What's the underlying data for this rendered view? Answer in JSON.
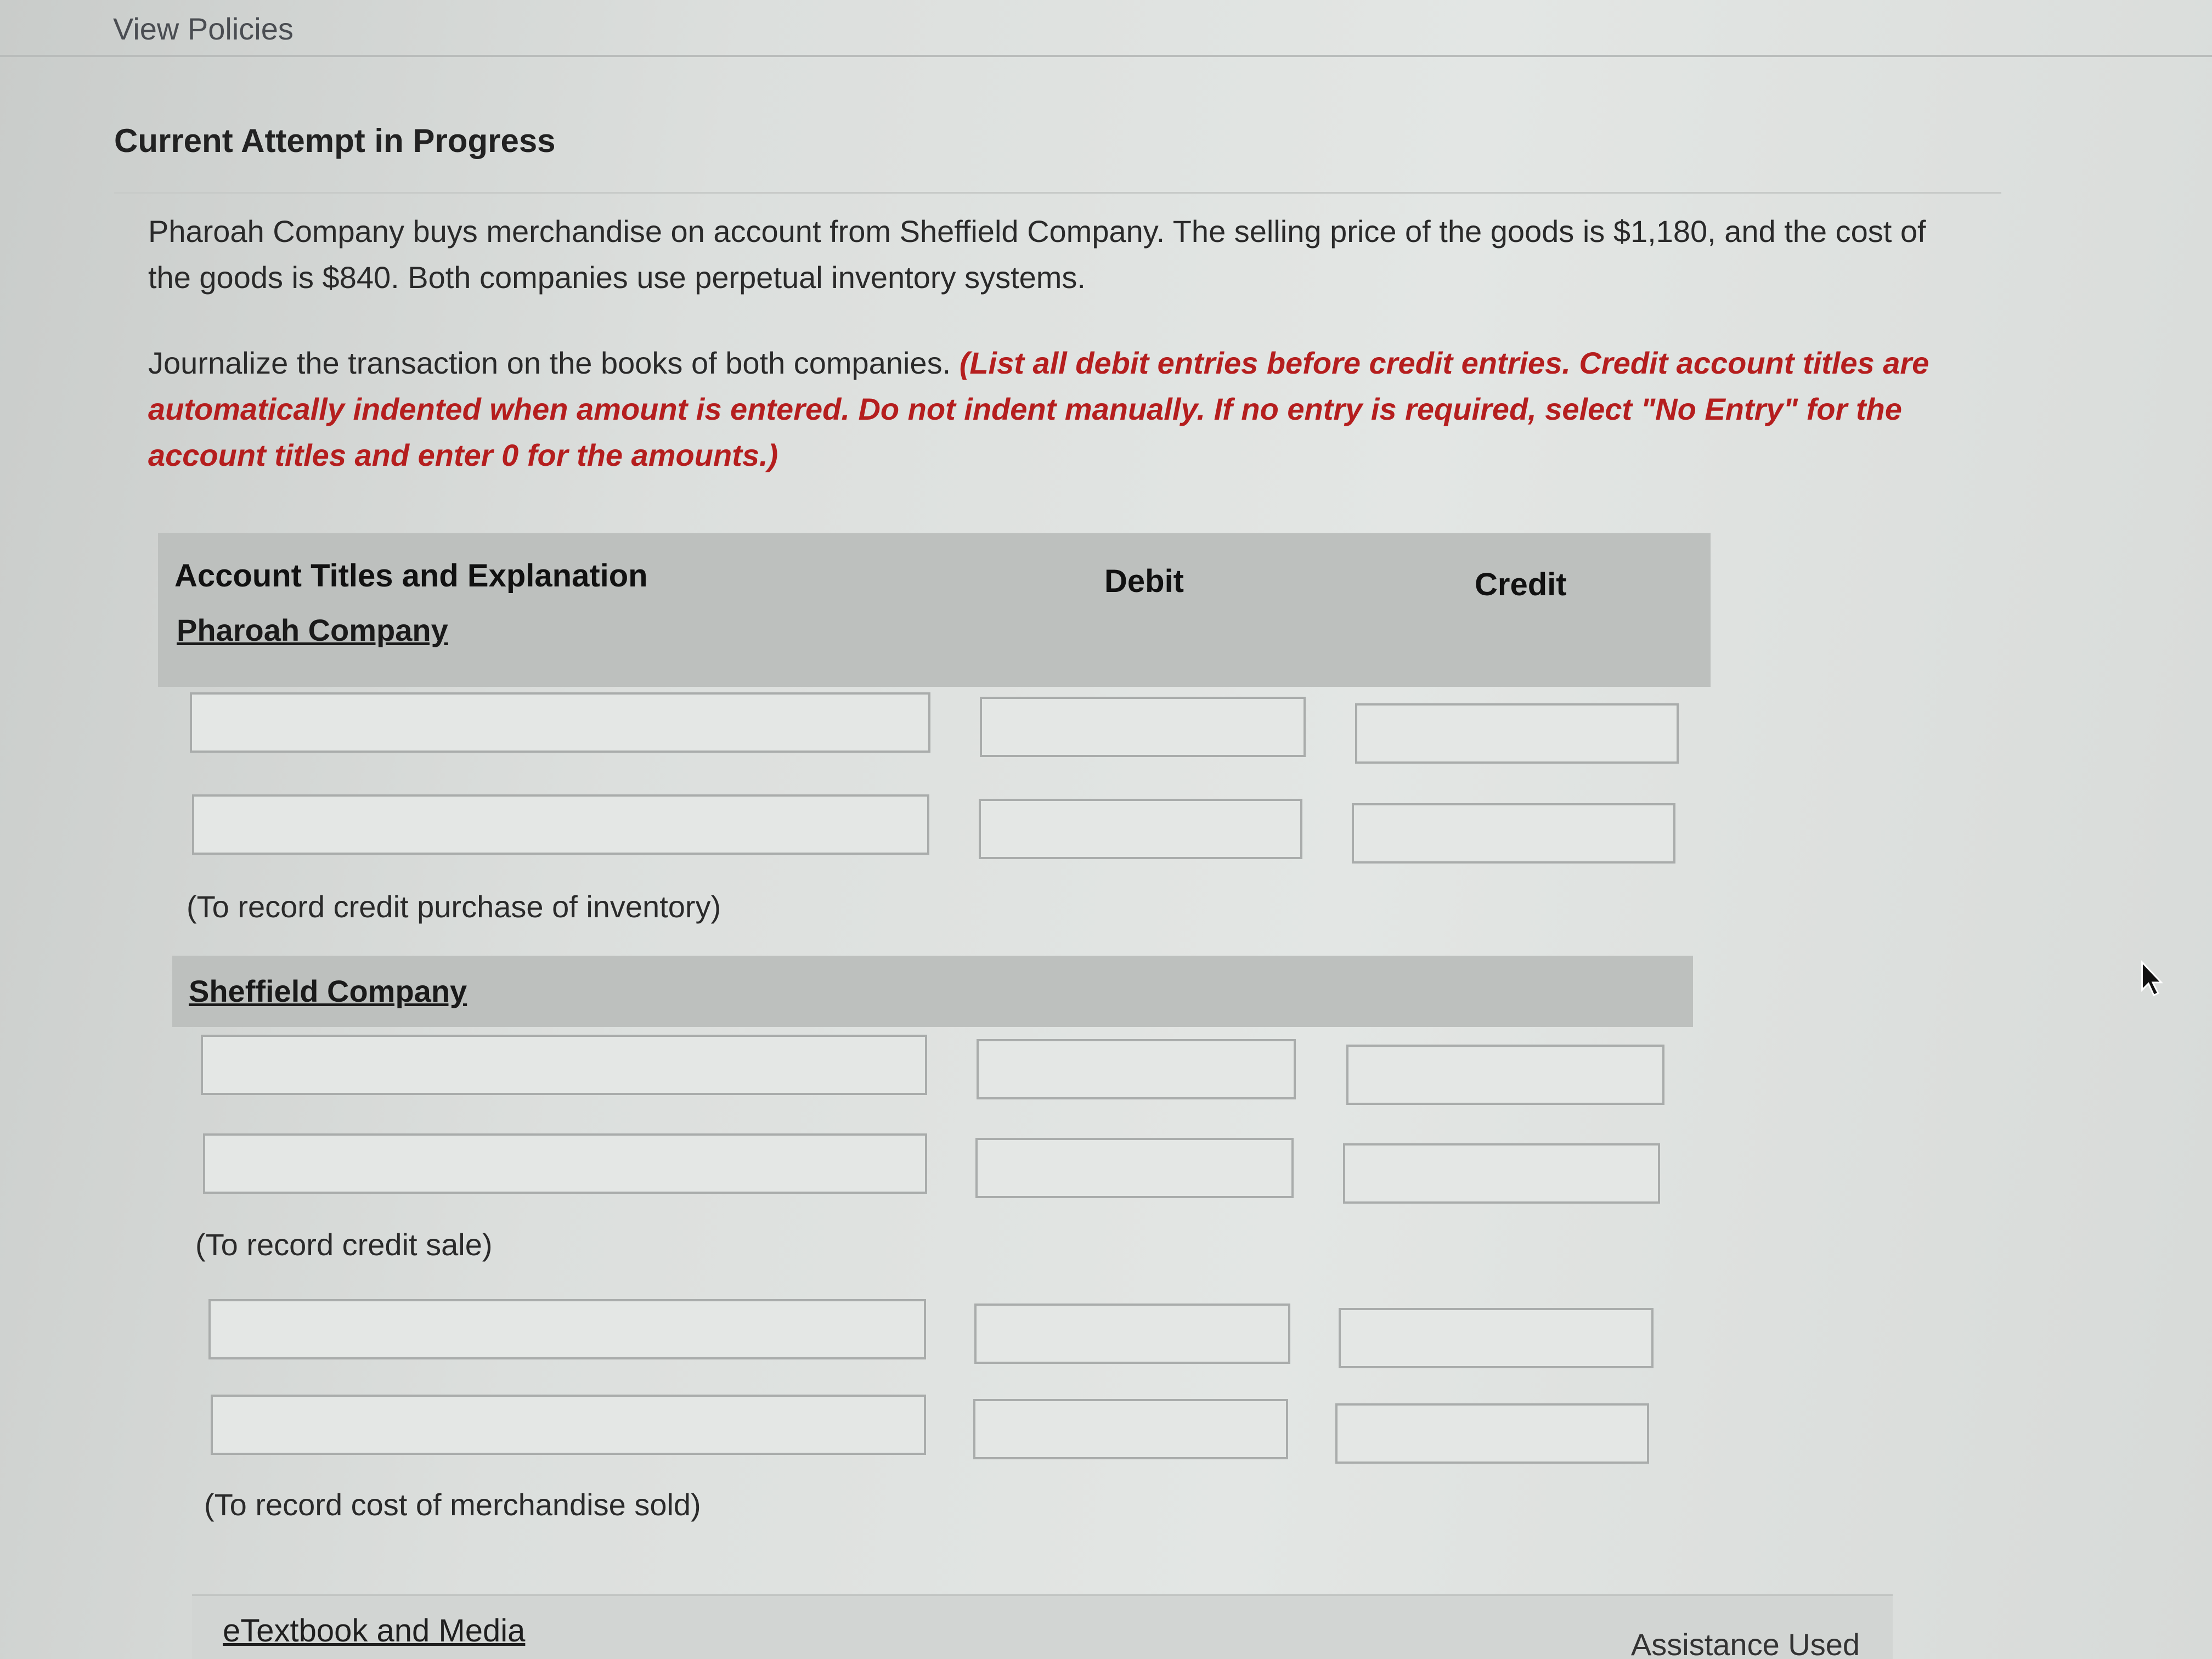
{
  "header": {
    "view_policies": "View Policies"
  },
  "attempt": {
    "title": "Current Attempt in Progress"
  },
  "question": {
    "text": "Pharoah Company buys merchandise on account from Sheffield Company. The selling price of the goods is $1,180, and the cost of the goods is $840. Both companies use perpetual inventory systems.",
    "prompt": "Journalize the transaction on the books of both companies.",
    "instruction": "(List all debit entries before credit entries. Credit account titles are automatically indented when amount is entered. Do not indent manually. If no entry is required, select \"No Entry\" for the account titles and enter 0 for the amounts.)"
  },
  "table": {
    "col_account": "Account Titles and Explanation",
    "col_debit": "Debit",
    "col_credit": "Credit"
  },
  "sections": {
    "pharoah": {
      "company": "Pharoah Company",
      "note": "(To record credit purchase of inventory)"
    },
    "sheffield": {
      "company": "Sheffield Company",
      "note_sale": "(To record credit sale)",
      "note_cost": "(To record cost of merchandise sold)"
    }
  },
  "footer": {
    "etextbook": "eTextbook and Media",
    "assistance": "Assistance Used"
  },
  "colors": {
    "instruction_red": "#b51e1e",
    "header_band": "#bdc0be"
  }
}
